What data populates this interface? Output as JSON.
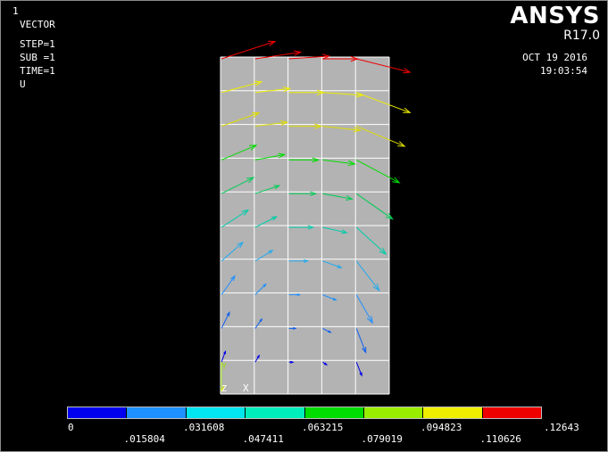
{
  "window": {
    "number": "1"
  },
  "info": {
    "plot_type": "VECTOR",
    "step": "STEP=1",
    "sub": "SUB =1",
    "time": "TIME=1",
    "quantity": "U"
  },
  "brand": {
    "logo": "ANSYS",
    "version": "R17.0"
  },
  "datetime": {
    "date": "OCT 19 2016",
    "time": "19:03:54"
  },
  "triad": {
    "y": "Y",
    "z": "Z",
    "x": "X"
  },
  "legend": {
    "colors": [
      "#0000ee",
      "#1e90ff",
      "#00e5ee",
      "#00eebb",
      "#00dd00",
      "#99ee00",
      "#eeee00",
      "#ee0000"
    ],
    "labels_top": [
      "0",
      ".031608",
      ".063215",
      ".094823",
      ".12643"
    ],
    "labels_bottom": [
      ".015804",
      ".047411",
      ".079019",
      ".110626"
    ]
  },
  "model": {
    "element_color": "#b3b3b3",
    "grid_columns": 5,
    "grid_rows": 10,
    "vector_rows": [
      {
        "color": "#ee0000",
        "vectors": [
          [
            0.4,
            0.13
          ],
          [
            0.34,
            0.05
          ],
          [
            0.3,
            0.02
          ],
          [
            0.26,
            0.0
          ],
          [
            0.4,
            -0.1
          ]
        ]
      },
      {
        "color": "#eeee00",
        "vectors": [
          [
            0.3,
            0.08
          ],
          [
            0.26,
            0.03
          ],
          [
            0.26,
            0.0
          ],
          [
            0.3,
            -0.02
          ],
          [
            0.4,
            -0.15
          ]
        ]
      },
      {
        "color": "#dddd00",
        "vectors": [
          [
            0.28,
            0.1
          ],
          [
            0.24,
            0.03
          ],
          [
            0.24,
            0.0
          ],
          [
            0.28,
            -0.03
          ],
          [
            0.36,
            -0.15
          ]
        ]
      },
      {
        "color": "#00dd00",
        "vectors": [
          [
            0.26,
            0.11
          ],
          [
            0.22,
            0.04
          ],
          [
            0.22,
            0.0
          ],
          [
            0.24,
            -0.03
          ],
          [
            0.32,
            -0.17
          ]
        ]
      },
      {
        "color": "#00cc55",
        "vectors": [
          [
            0.24,
            0.12
          ],
          [
            0.18,
            0.06
          ],
          [
            0.2,
            0.0
          ],
          [
            0.22,
            -0.04
          ],
          [
            0.27,
            -0.19
          ]
        ]
      },
      {
        "color": "#00ccaa",
        "vectors": [
          [
            0.2,
            0.13
          ],
          [
            0.16,
            0.08
          ],
          [
            0.18,
            0.0
          ],
          [
            0.18,
            -0.04
          ],
          [
            0.22,
            -0.2
          ]
        ]
      },
      {
        "color": "#22aaee",
        "vectors": [
          [
            0.16,
            0.14
          ],
          [
            0.13,
            0.08
          ],
          [
            0.14,
            0.0
          ],
          [
            0.14,
            -0.05
          ],
          [
            0.17,
            -0.22
          ]
        ]
      },
      {
        "color": "#1e90ff",
        "vectors": [
          [
            0.1,
            0.14
          ],
          [
            0.08,
            0.08
          ],
          [
            0.08,
            0.0
          ],
          [
            0.1,
            -0.04
          ],
          [
            0.12,
            -0.21
          ]
        ]
      },
      {
        "color": "#1060ee",
        "vectors": [
          [
            0.06,
            0.12
          ],
          [
            0.05,
            0.07
          ],
          [
            0.05,
            0.0
          ],
          [
            0.06,
            -0.03
          ],
          [
            0.07,
            -0.18
          ]
        ]
      },
      {
        "color": "#0000ee",
        "vectors": [
          [
            0.03,
            0.08
          ],
          [
            0.03,
            0.05
          ],
          [
            0.03,
            0.0
          ],
          [
            0.03,
            -0.02
          ],
          [
            0.04,
            -0.1
          ]
        ]
      }
    ]
  }
}
